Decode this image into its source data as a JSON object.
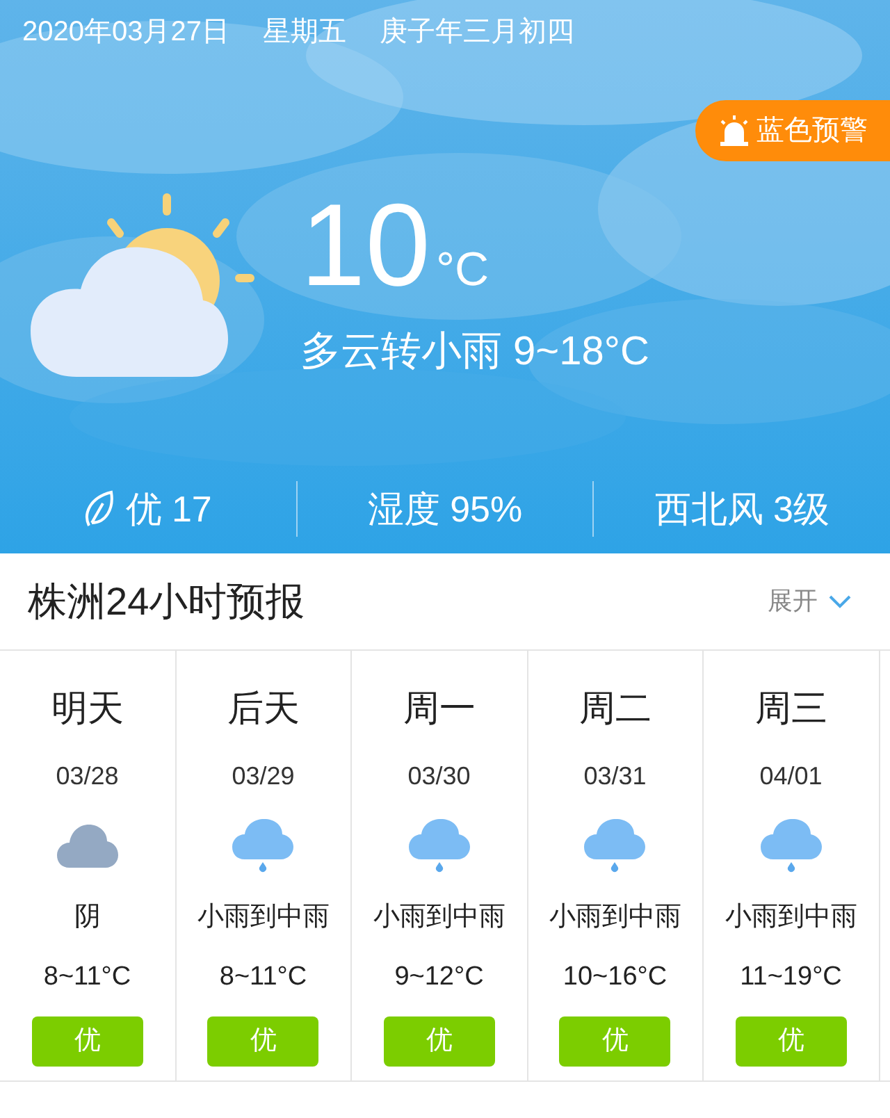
{
  "header": {
    "date": "2020年03月27日",
    "weekday": "星期五",
    "lunar": "庚子年三月初四"
  },
  "alert": {
    "label": "蓝色预警"
  },
  "current": {
    "temperature": "10",
    "unit": "°C",
    "description": "多云转小雨 9~18°C"
  },
  "stats": [
    {
      "kind": "air",
      "text": "优 17"
    },
    {
      "kind": "plain",
      "text": "湿度 95%"
    },
    {
      "kind": "plain",
      "text": "西北风 3级"
    }
  ],
  "forecast": {
    "title": "株洲24小时预报",
    "toggle": "展开",
    "days": [
      {
        "day": "明天",
        "date": "03/28",
        "kind": "overcast",
        "weather": "阴",
        "temp": "8~11°C",
        "aqi": "优",
        "color": "#7ccd00"
      },
      {
        "day": "后天",
        "date": "03/29",
        "kind": "rain",
        "weather": "小雨到中雨",
        "temp": "8~11°C",
        "aqi": "优",
        "color": "#7ccd00"
      },
      {
        "day": "周一",
        "date": "03/30",
        "kind": "rain",
        "weather": "小雨到中雨",
        "temp": "9~12°C",
        "aqi": "优",
        "color": "#7ccd00"
      },
      {
        "day": "周二",
        "date": "03/31",
        "kind": "rain",
        "weather": "小雨到中雨",
        "temp": "10~16°C",
        "aqi": "优",
        "color": "#7ccd00"
      },
      {
        "day": "周三",
        "date": "04/01",
        "kind": "rain",
        "weather": "小雨到中雨",
        "temp": "11~19°C",
        "aqi": "优",
        "color": "#7ccd00"
      }
    ]
  }
}
